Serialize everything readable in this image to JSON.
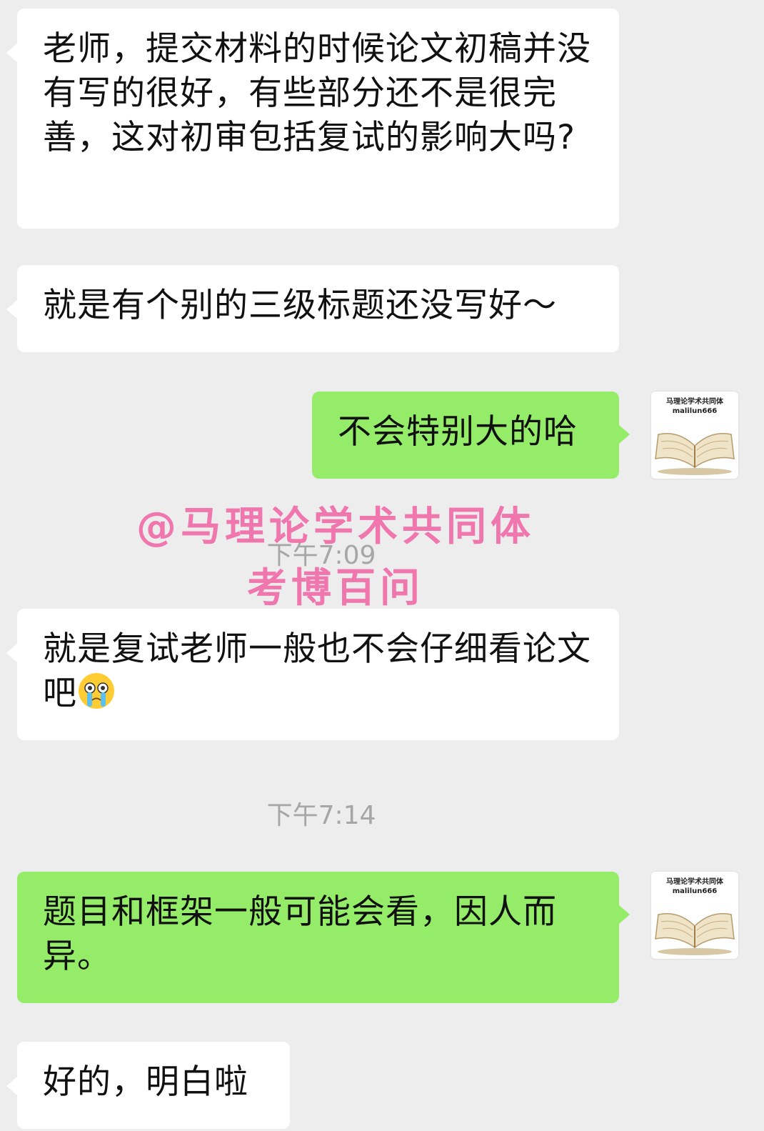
{
  "messages": [
    {
      "text": "老师，提交材料的时候论文初稿并没有写的很好，有些部分还不是很完善，这对初审包括复试的影响大吗?"
    },
    {
      "text": "就是有个别的三级标题还没写好～"
    },
    {
      "text": "不会特别大的哈"
    },
    {
      "text": "就是复试老师一般也不会仔细看论文吧",
      "emoji": "crying-face"
    },
    {
      "text": "题目和框架一般可能会看，因人而异。"
    },
    {
      "text": "好的，明白啦"
    }
  ],
  "timestamps": [
    "下午7:09",
    "下午7:14"
  ],
  "avatar": {
    "line1": "马理论学术共同体",
    "line2": "malilun666"
  },
  "watermark": {
    "line1": "@马理论学术共同体",
    "line2": "考博百问"
  },
  "colors": {
    "background": "#ededed",
    "incoming": "#ffffff",
    "outgoing": "#95ec69",
    "watermark": "#f06ba8"
  }
}
